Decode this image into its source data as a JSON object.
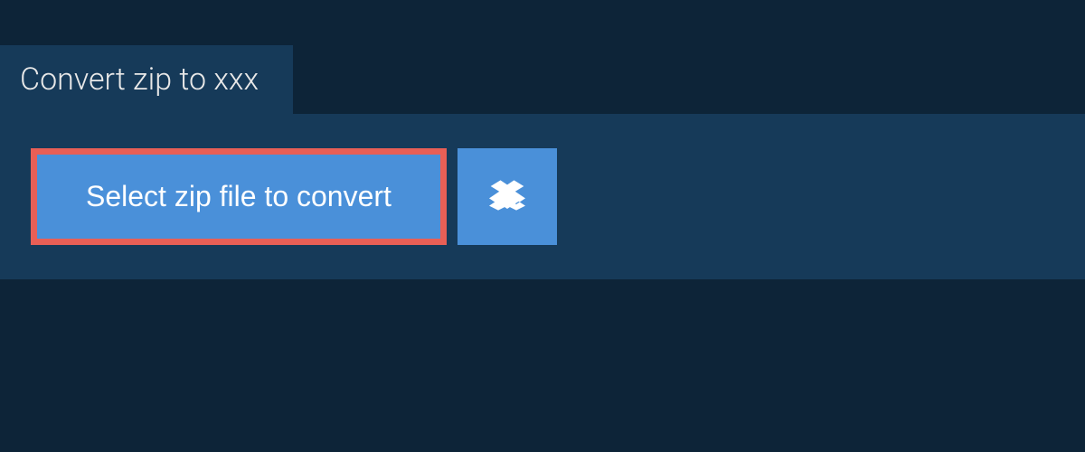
{
  "tab": {
    "title": "Convert zip to xxx"
  },
  "actions": {
    "select_file_label": "Select zip file to convert"
  },
  "colors": {
    "bg": "#0d2438",
    "panel": "#163a59",
    "button": "#4a90d9",
    "highlight": "#e85f56"
  }
}
